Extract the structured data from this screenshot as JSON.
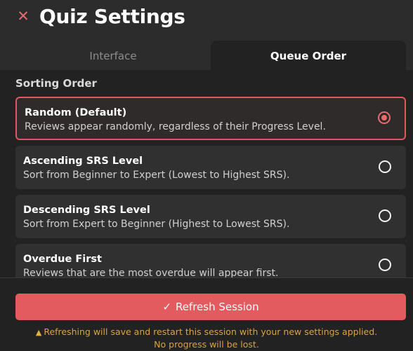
{
  "header": {
    "close_icon": "close-icon",
    "title": "Quiz Settings"
  },
  "tabs": [
    {
      "label": "Interface",
      "active": false
    },
    {
      "label": "Queue Order",
      "active": true
    }
  ],
  "section": {
    "title": "Sorting Order"
  },
  "options": [
    {
      "title": "Random (Default)",
      "description": "Reviews appear randomly, regardless of their Progress Level.",
      "selected": true
    },
    {
      "title": "Ascending SRS Level",
      "description": "Sort from Beginner to Expert (Lowest to Highest SRS).",
      "selected": false
    },
    {
      "title": "Descending SRS Level",
      "description": "Sort from Expert to Beginner (Highest to Lowest SRS).",
      "selected": false
    },
    {
      "title": "Overdue First",
      "description": "Reviews that are the most overdue will appear first.",
      "selected": false
    }
  ],
  "footer": {
    "button_label": "Refresh Session",
    "button_icon": "check-icon",
    "warning_icon": "warning-icon",
    "warning_line1": "Refreshing will save and restart this session with your new settings applied.",
    "warning_line2": "No progress will be lost."
  },
  "colors": {
    "accent": "#e35a5f",
    "warning": "#d9a441",
    "background": "#222222",
    "panel": "#2c2c2c"
  }
}
